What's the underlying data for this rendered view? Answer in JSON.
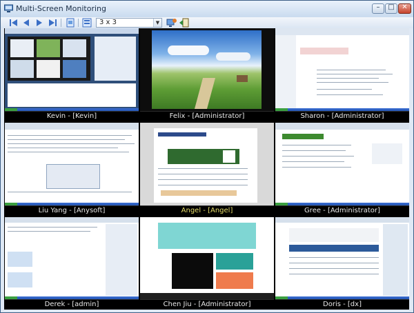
{
  "window": {
    "title": "Multi-Screen Monitoring"
  },
  "controls": {
    "minimize": "–",
    "maximize": "□",
    "close": "✕"
  },
  "toolbar": {
    "layout_value": "3 x 3",
    "icons": [
      "first-icon",
      "previous-icon",
      "play-icon",
      "last-icon",
      "page-icon",
      "layout-icon",
      "monitor-icon",
      "exit-icon"
    ]
  },
  "screens": [
    {
      "caption": "Kevin - [Kevin]",
      "selected": false
    },
    {
      "caption": "Felix - [Administrator]",
      "selected": false
    },
    {
      "caption": "Sharon - [Administrator]",
      "selected": false
    },
    {
      "caption": "Liu Yang - [Anysoft]",
      "selected": false
    },
    {
      "caption": "Angel - [Angel]",
      "selected": true
    },
    {
      "caption": "Gree - [Administrator]",
      "selected": false
    },
    {
      "caption": "Derek - [admin]",
      "selected": false
    },
    {
      "caption": "Chen Jiu - [Administrator]",
      "selected": false
    },
    {
      "caption": "Doris - [dx]",
      "selected": false
    }
  ],
  "colors": {
    "accent": "#1f4fa8",
    "selected_caption": "#e8de6a",
    "grid_background": "#000000"
  }
}
